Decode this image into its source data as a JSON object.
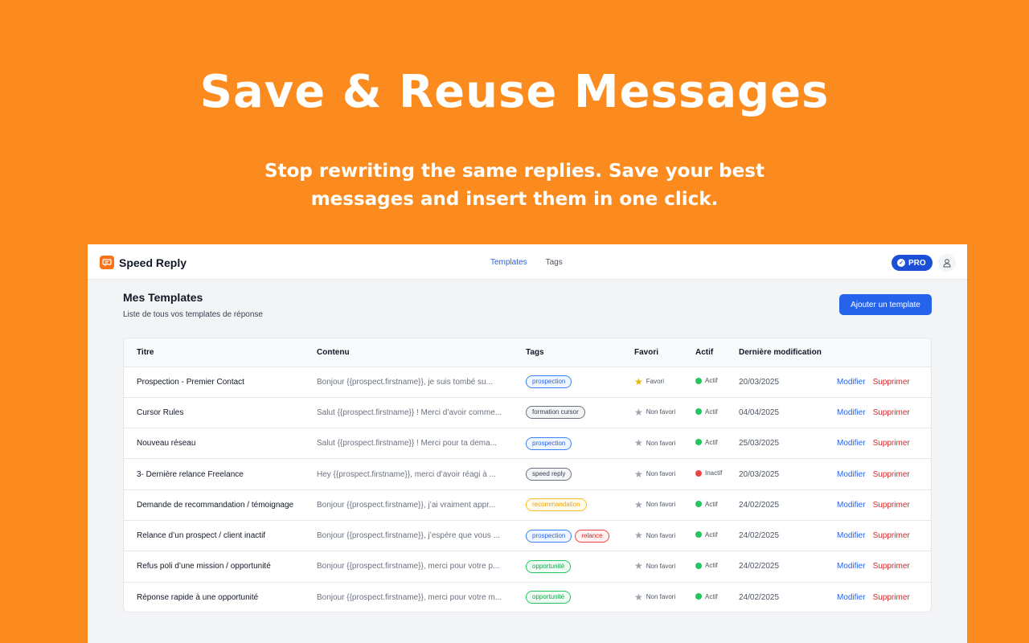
{
  "hero": {
    "title": "Save & Reuse Messages",
    "subtitle_line1": "Stop rewriting the same replies. Save your best",
    "subtitle_line2": "messages and insert them in one click."
  },
  "nav": {
    "brand": "Speed Reply",
    "links": [
      {
        "label": "Templates",
        "active": true
      },
      {
        "label": "Tags",
        "active": false
      }
    ],
    "pro_label": "PRO"
  },
  "page": {
    "title": "Mes Templates",
    "subtitle": "Liste de tous vos templates de réponse",
    "add_button": "Ajouter un template"
  },
  "table": {
    "headers": [
      "Titre",
      "Contenu",
      "Tags",
      "Favori",
      "Actif",
      "Dernière modification",
      ""
    ],
    "edit_label": "Modifier",
    "delete_label": "Supprimer",
    "rows": [
      {
        "title": "Prospection - Premier Contact",
        "content": "Bonjour {{prospect.firstname}}, je suis tombé su...",
        "tags": [
          {
            "label": "prospection",
            "color": "blue"
          }
        ],
        "favorite": true,
        "favorite_label": "Favori",
        "active": true,
        "active_label": "Actif",
        "date": "20/03/2025"
      },
      {
        "title": "Cursor Rules",
        "content": "Salut {{prospect.firstname}} ! Merci d’avoir comme...",
        "tags": [
          {
            "label": "formation cursor",
            "color": "gray"
          }
        ],
        "favorite": false,
        "favorite_label": "Non favori",
        "active": true,
        "active_label": "Actif",
        "date": "04/04/2025"
      },
      {
        "title": "Nouveau réseau",
        "content": "Salut {{prospect.firstname}} ! Merci pour ta dema...",
        "tags": [
          {
            "label": "prospection",
            "color": "blue"
          }
        ],
        "favorite": false,
        "favorite_label": "Non favori",
        "active": true,
        "active_label": "Actif",
        "date": "25/03/2025"
      },
      {
        "title": "3- Dernière relance Freelance",
        "content": "Hey {{prospect.firstname}}, merci d’avoir réagi à ...",
        "tags": [
          {
            "label": "speed reply",
            "color": "gray"
          }
        ],
        "favorite": false,
        "favorite_label": "Non favori",
        "active": false,
        "active_label": "Inactif",
        "date": "20/03/2025"
      },
      {
        "title": "Demande de recommandation / témoignage",
        "content": "Bonjour {{prospect.firstname}}, j’ai vraiment appr...",
        "tags": [
          {
            "label": "recommandation",
            "color": "orange"
          }
        ],
        "favorite": false,
        "favorite_label": "Non favori",
        "active": true,
        "active_label": "Actif",
        "date": "24/02/2025"
      },
      {
        "title": "Relance d’un prospect / client inactif",
        "content": "Bonjour {{prospect.firstname}}, j’espère que vous ...",
        "tags": [
          {
            "label": "prospection",
            "color": "blue"
          },
          {
            "label": "relance",
            "color": "red"
          }
        ],
        "favorite": false,
        "favorite_label": "Non favori",
        "active": true,
        "active_label": "Actif",
        "date": "24/02/2025"
      },
      {
        "title": "Refus poli d’une mission / opportunité",
        "content": "Bonjour {{prospect.firstname}}, merci pour votre p...",
        "tags": [
          {
            "label": "opportunité",
            "color": "green"
          }
        ],
        "favorite": false,
        "favorite_label": "Non favori",
        "active": true,
        "active_label": "Actif",
        "date": "24/02/2025"
      },
      {
        "title": "Réponse rapide à une opportunité",
        "content": "Bonjour {{prospect.firstname}}, merci pour votre m...",
        "tags": [
          {
            "label": "opportunité",
            "color": "green"
          }
        ],
        "favorite": false,
        "favorite_label": "Non favori",
        "active": true,
        "active_label": "Actif",
        "date": "24/02/2025"
      }
    ]
  },
  "colors": {
    "background": "#fb8b1e",
    "accent": "#2563eb",
    "danger": "#dc2626",
    "active_dot": "#22c55e",
    "inactive_dot": "#ef4444",
    "star": "#eab308"
  },
  "icons": {
    "brand": "chat-bubble-icon",
    "pro": "check-circle-icon",
    "avatar": "user-icon",
    "favorite": "star-icon"
  }
}
